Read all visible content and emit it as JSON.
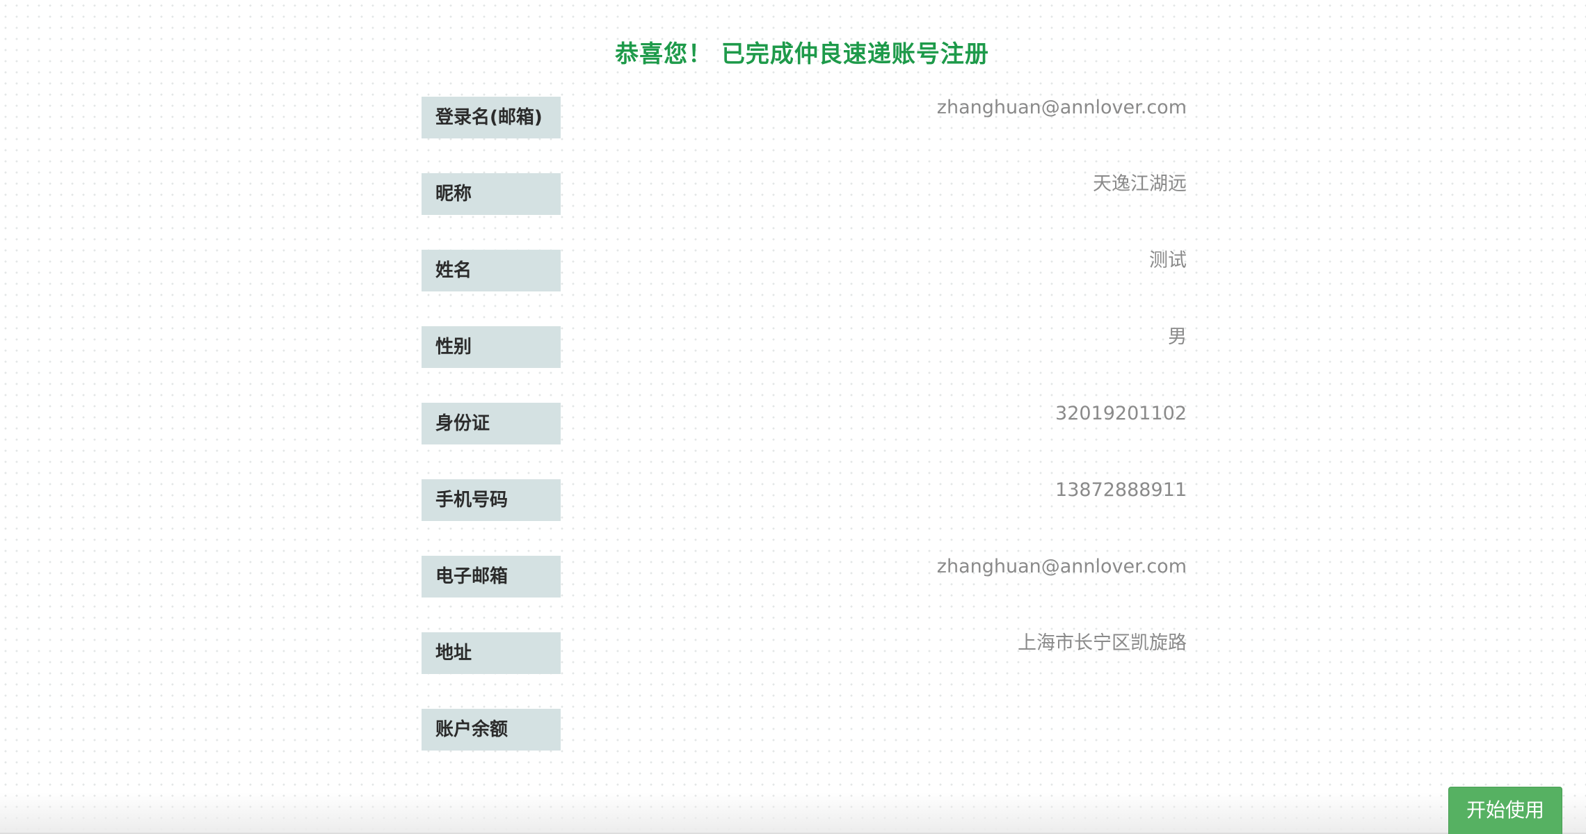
{
  "title": "恭喜您！ 已完成仲良速递账号注册",
  "fields": [
    {
      "label": "登录名(邮箱)",
      "value": "zhanghuan@annlover.com"
    },
    {
      "label": "昵称",
      "value": "天逸江湖远"
    },
    {
      "label": "姓名",
      "value": "测试"
    },
    {
      "label": "性别",
      "value": "男"
    },
    {
      "label": "身份证",
      "value": "32019201102"
    },
    {
      "label": "手机号码",
      "value": "13872888911"
    },
    {
      "label": "电子邮箱",
      "value": "zhanghuan@annlover.com"
    },
    {
      "label": "地址",
      "value": "上海市长宁区凯旋路"
    },
    {
      "label": "账户余额",
      "value": ""
    }
  ],
  "start_button_label": "开始使用",
  "colors": {
    "title": "#1e9a4a",
    "label_bg": "#d4e1e2",
    "value_text": "#8a8a8a",
    "button_bg": "#56b162"
  }
}
